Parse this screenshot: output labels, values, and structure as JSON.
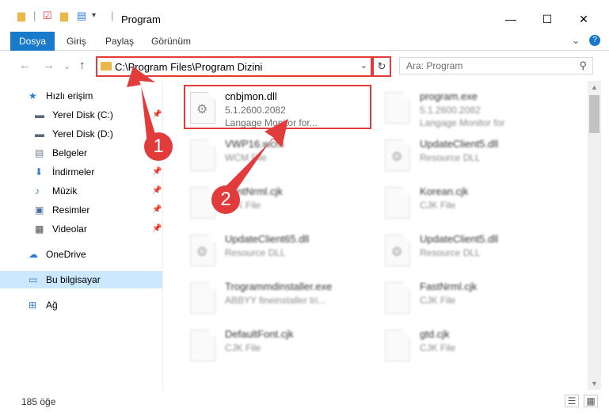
{
  "window": {
    "title": "Program",
    "minimize": "—",
    "maximize": "☐",
    "close": "✕"
  },
  "ribbon": {
    "tabs": [
      "Dosya",
      "Giriş",
      "Paylaş",
      "Görünüm"
    ],
    "expand": "⌄",
    "help": "?"
  },
  "nav": {
    "back": "←",
    "forward": "→",
    "recent": "⌄",
    "up": "↑",
    "address": "C:\\Program Files\\Program Dizini",
    "address_dropdown": "⌄",
    "refresh": "↻",
    "search_placeholder": "Ara: Program",
    "search_icon": "⚲"
  },
  "sidebar": {
    "items": [
      {
        "label": "Hızlı erişim",
        "icon": "star-icon",
        "glyph": "★",
        "color": "#2b7cd3",
        "pinned": false
      },
      {
        "label": "Yerel Disk (C:)",
        "icon": "drive-icon",
        "glyph": "▬",
        "color": "#5a6a7a",
        "pinned": true
      },
      {
        "label": "Yerel Disk (D:)",
        "icon": "drive-icon",
        "glyph": "▬",
        "color": "#5a6a7a",
        "pinned": false
      },
      {
        "label": "Belgeler",
        "icon": "documents-icon",
        "glyph": "▤",
        "color": "#6b7b8b",
        "pinned": false
      },
      {
        "label": "İndirmeler",
        "icon": "download-icon",
        "glyph": "⬇",
        "color": "#2b7cd3",
        "pinned": true
      },
      {
        "label": "Müzik",
        "icon": "music-icon",
        "glyph": "♪",
        "color": "#2b7cd3",
        "pinned": true
      },
      {
        "label": "Resimler",
        "icon": "pictures-icon",
        "glyph": "▣",
        "color": "#4a6f9a",
        "pinned": true
      },
      {
        "label": "Videolar",
        "icon": "video-icon",
        "glyph": "▦",
        "color": "#4a4a4a",
        "pinned": true
      },
      {
        "label": "OneDrive",
        "icon": "cloud-icon",
        "glyph": "☁",
        "color": "#2b7cd3",
        "pinned": false
      },
      {
        "label": "Bu bilgisayar",
        "icon": "computer-icon",
        "glyph": "▭",
        "color": "#2b7cd3",
        "pinned": false,
        "selected": true
      },
      {
        "label": "Ağ",
        "icon": "network-icon",
        "glyph": "⊞",
        "color": "#2b7cd3",
        "pinned": false
      }
    ]
  },
  "files": [
    {
      "name": "cnbjmon.dll",
      "line2": "5.1.2600.2082",
      "line3": "Langage Monitor for...",
      "highlight": true
    },
    {
      "name": "program.exe",
      "line2": "5.1.2600.2082",
      "line3": "Langage Monitor for",
      "blur": true
    },
    {
      "name": "VWP16.wcm",
      "line2": "WCM File",
      "line3": "",
      "blur": true
    },
    {
      "name": "UpdateClient5.dll",
      "line2": "Resource DLL",
      "line3": "",
      "blur": true
    },
    {
      "name": "FontNrml.cjk",
      "line2": "CJK File",
      "line3": "",
      "blur": true
    },
    {
      "name": "Korean.cjk",
      "line2": "CJK File",
      "line3": "",
      "blur": true
    },
    {
      "name": "UpdateClient65.dll",
      "line2": "Resource DLL",
      "line3": "",
      "blur": true
    },
    {
      "name": "UpdateClient5.dll",
      "line2": "Resource DLL",
      "line3": "",
      "blur": true
    },
    {
      "name": "Trogrammdinstaller.exe",
      "line2": "ABBYY fineinstaller tri...",
      "line3": "",
      "blur": true
    },
    {
      "name": "FastNrml.cjk",
      "line2": "CJK File",
      "line3": "",
      "blur": true
    },
    {
      "name": "DefaultFont.cjk",
      "line2": "CJK File",
      "line3": "",
      "blur": true
    },
    {
      "name": "gtd.cjk",
      "line2": "CJK File",
      "line3": "",
      "blur": true
    }
  ],
  "status": {
    "count": "185 öğe"
  },
  "callouts": [
    "1",
    "2"
  ],
  "colors": {
    "accent": "#1979ca",
    "highlight": "#e23b3b",
    "selected": "#cce8ff"
  }
}
